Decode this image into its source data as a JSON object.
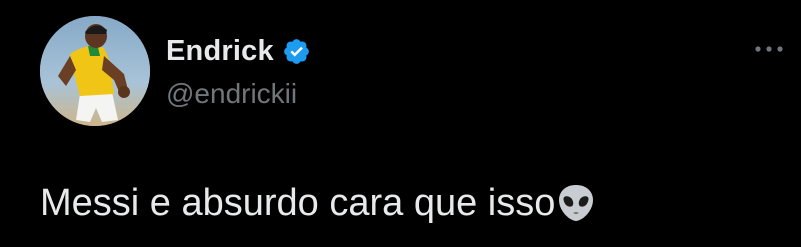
{
  "tweet": {
    "author": {
      "display_name": "Endrick",
      "handle": "@endrickii",
      "verified": true,
      "avatar_icon": "profile-photo"
    },
    "text": "Messi e absurdo cara que isso",
    "emoji": "alien-emoji",
    "menu_icon": "more-options-icon"
  },
  "colors": {
    "background": "#000000",
    "primary_text": "#e7e9ea",
    "secondary_text": "#71767b",
    "verified_badge": "#1d9bf0"
  }
}
